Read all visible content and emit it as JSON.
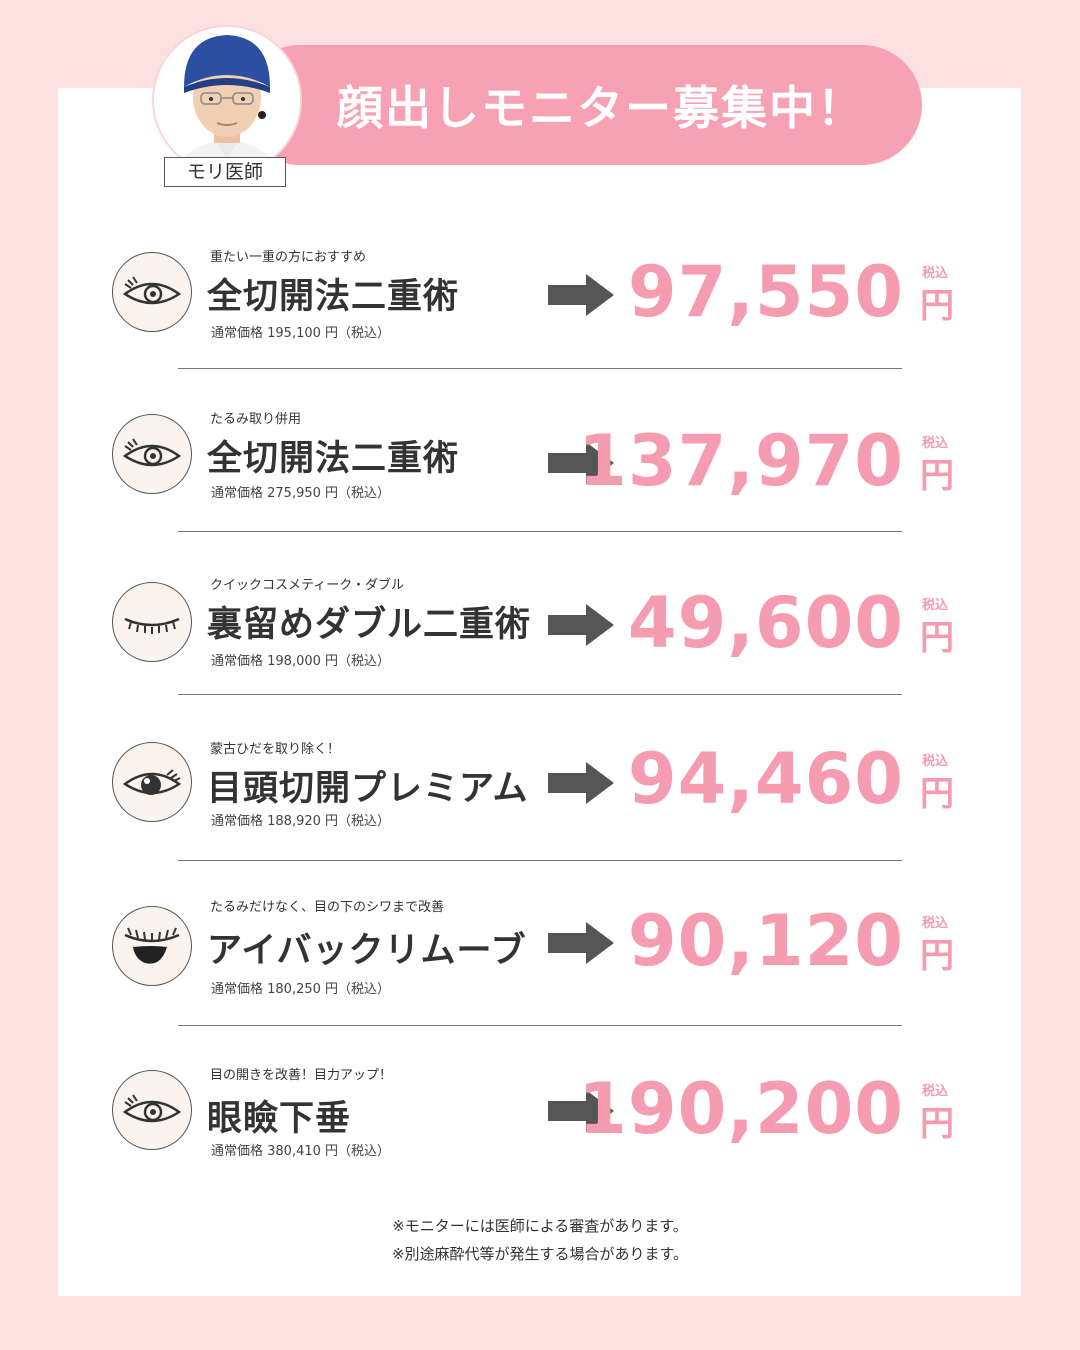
{
  "header": {
    "title": "顔出しモニター募集中！",
    "doctor_label": "モリ医師"
  },
  "treatments": [
    {
      "subtitle": "重たい一重の方におすすめ",
      "name": "全切開法二重術",
      "regular": "通常価格 195,100 円（税込）",
      "price": "97,550",
      "tax": "税込",
      "yen": "円",
      "icon": "open-eye-icon"
    },
    {
      "subtitle": "たるみ取り併用",
      "name": "全切開法二重術",
      "regular": "通常価格 275,950 円（税込）",
      "price": "137,970",
      "tax": "税込",
      "yen": "円",
      "icon": "open-eye-icon"
    },
    {
      "subtitle": "クイックコスメティーク・ダブル",
      "name": "裏留めダブル二重術",
      "regular": "通常価格 198,000 円（税込）",
      "price": "49,600",
      "tax": "税込",
      "yen": "円",
      "icon": "closed-eye-icon"
    },
    {
      "subtitle": "蒙古ひだを取り除く！",
      "name": "目頭切開プレミアム",
      "regular": "通常価格 188,920 円（税込）",
      "price": "94,460",
      "tax": "税込",
      "yen": "円",
      "icon": "large-pupil-eye-icon"
    },
    {
      "subtitle": "たるみだけなく、目の下のシワまで改善",
      "name": "アイバックリムーブ",
      "regular": "通常価格 180,250 円（税込）",
      "price": "90,120",
      "tax": "税込",
      "yen": "円",
      "icon": "under-eye-bag-icon"
    },
    {
      "subtitle": "目の開きを改善！目力アップ！",
      "name": "眼瞼下垂",
      "regular": "通常価格 380,410 円（税込）",
      "price": "190,200",
      "tax": "税込",
      "yen": "円",
      "icon": "open-eye-icon"
    }
  ],
  "notes": [
    "※モニターには医師による審査があります。",
    "※別途麻酔代等が発生する場合があります。"
  ]
}
